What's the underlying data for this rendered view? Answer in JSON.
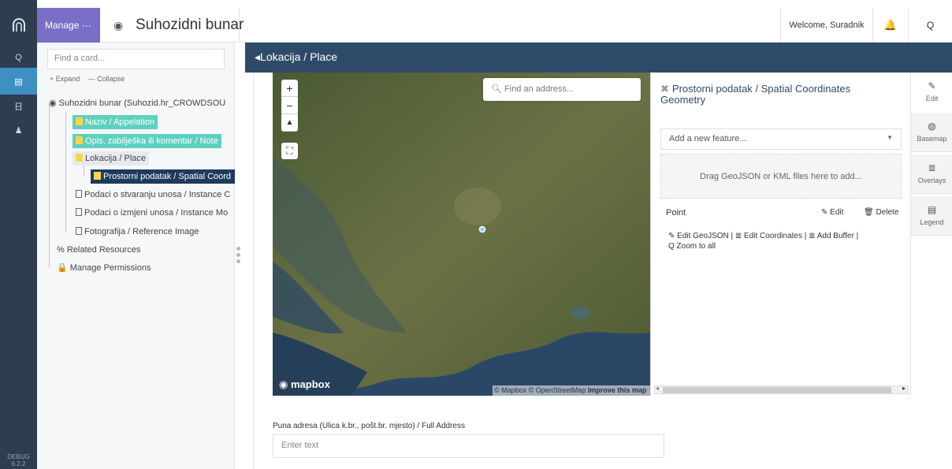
{
  "app": {
    "manage_label": "Manage ···",
    "title": "Suhozidni bunar",
    "welcome": "Welcome, Suradnik",
    "debug_version": "DEBUG 6.2.2"
  },
  "tree": {
    "search_placeholder": "Find a card...",
    "expand_label": "+ Expand",
    "collapse_label": "— Collapse",
    "root_label": "Suhozidni bunar (Suhozid.hr_CROWDSOU",
    "nodes": [
      {
        "label": "Naziv / Appelation"
      },
      {
        "label": "Opis, zabilješka ili komentar / Note"
      },
      {
        "label": "Lokacija / Place"
      },
      {
        "label": "Prostorni podatak / Spatial Coord"
      },
      {
        "label": "Podaci o stvaranju unosa / Instance C"
      },
      {
        "label": "Podaci o izmjeni unosa / Instance Mo"
      },
      {
        "label": "Fotografija / Reference Image"
      }
    ],
    "related_resources": "Related Resources",
    "manage_permissions": "Manage Permissions"
  },
  "card_header": "Lokacija / Place",
  "map": {
    "address_placeholder": "Find an address...",
    "zoom_in": "+",
    "zoom_out": "−",
    "compass": "▲",
    "fullscreen": "⛶",
    "logo_text": "mapbox",
    "attribution_prefix": "© Mapbox © OpenStreetMap ",
    "attribution_link": "Improve this map"
  },
  "geometry": {
    "title": "Prostorni podatak / Spatial Coordinates Geometry",
    "feature_select": "Add a new feature...",
    "drop_text": "Drag GeoJSON or KML files here to add...",
    "point_label": "Point",
    "edit": "Edit",
    "delete": "Delete",
    "links": "✎ Edit GeoJSON  | ≣ Edit Coordinates | ≣ Add Buffer | ",
    "zoom_all": "Q Zoom to all"
  },
  "tools": [
    {
      "label": "Edit",
      "icon": "✎"
    },
    {
      "label": "Basemap",
      "icon": "◍"
    },
    {
      "label": "Overlays",
      "icon": "≣"
    },
    {
      "label": "Legend",
      "icon": "▤"
    }
  ],
  "address": {
    "label": "Puna adresa (Ulica k.br., pošt.br. mjesto) / Full Address",
    "placeholder": "Enter text"
  }
}
